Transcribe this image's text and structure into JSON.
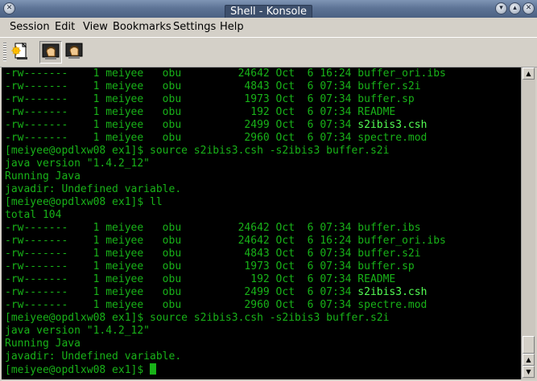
{
  "window": {
    "title": "Shell - Konsole"
  },
  "menu": [
    "Session",
    "Edit",
    "View",
    "Bookmarks",
    "Settings",
    "Help"
  ],
  "toolbar": {
    "icons": [
      "new-session-icon",
      "terminal-icon",
      "terminal-icon"
    ]
  },
  "terminal": {
    "lines": [
      {
        "text": "-rw-------    1 meiyee   obu         24642 Oct  6 16:24 buffer_ori.ibs"
      },
      {
        "text": "-rw-------    1 meiyee   obu          4843 Oct  6 07:34 buffer.s2i"
      },
      {
        "text": "-rw-------    1 meiyee   obu          1973 Oct  6 07:34 buffer.sp"
      },
      {
        "text": "-rw-------    1 meiyee   obu           192 Oct  6 07:34 README"
      },
      {
        "pre": "-rw-------    1 meiyee   obu          2499 Oct  6 07:34 ",
        "hl": "s2ibis3.csh"
      },
      {
        "text": "-rw-------    1 meiyee   obu          2960 Oct  6 07:34 spectre.mod"
      },
      {
        "text": "[meiyee@opdlxw08 ex1]$ source s2ibis3.csh -s2ibis3 buffer.s2i"
      },
      {
        "text": "java version \"1.4.2_12\""
      },
      {
        "text": "Running Java"
      },
      {
        "text": "javadir: Undefined variable."
      },
      {
        "text": "[meiyee@opdlxw08 ex1]$ ll"
      },
      {
        "text": "total 104"
      },
      {
        "text": "-rw-------    1 meiyee   obu         24642 Oct  6 07:34 buffer.ibs"
      },
      {
        "text": "-rw-------    1 meiyee   obu         24642 Oct  6 16:24 buffer_ori.ibs"
      },
      {
        "text": "-rw-------    1 meiyee   obu          4843 Oct  6 07:34 buffer.s2i"
      },
      {
        "text": "-rw-------    1 meiyee   obu          1973 Oct  6 07:34 buffer.sp"
      },
      {
        "text": "-rw-------    1 meiyee   obu           192 Oct  6 07:34 README"
      },
      {
        "pre": "-rw-------    1 meiyee   obu          2499 Oct  6 07:34 ",
        "hl": "s2ibis3.csh"
      },
      {
        "text": "-rw-------    1 meiyee   obu          2960 Oct  6 07:34 spectre.mod"
      },
      {
        "text": "[meiyee@opdlxw08 ex1]$ source s2ibis3.csh -s2ibis3 buffer.s2i"
      },
      {
        "text": "java version \"1.4.2_12\""
      },
      {
        "text": "Running Java"
      },
      {
        "text": "javadir: Undefined variable."
      },
      {
        "text": "[meiyee@opdlxw08 ex1]$ ",
        "cursor": true
      }
    ],
    "colors": {
      "background": "#000000",
      "text": "#18b218",
      "highlight": "#54ff54"
    }
  }
}
